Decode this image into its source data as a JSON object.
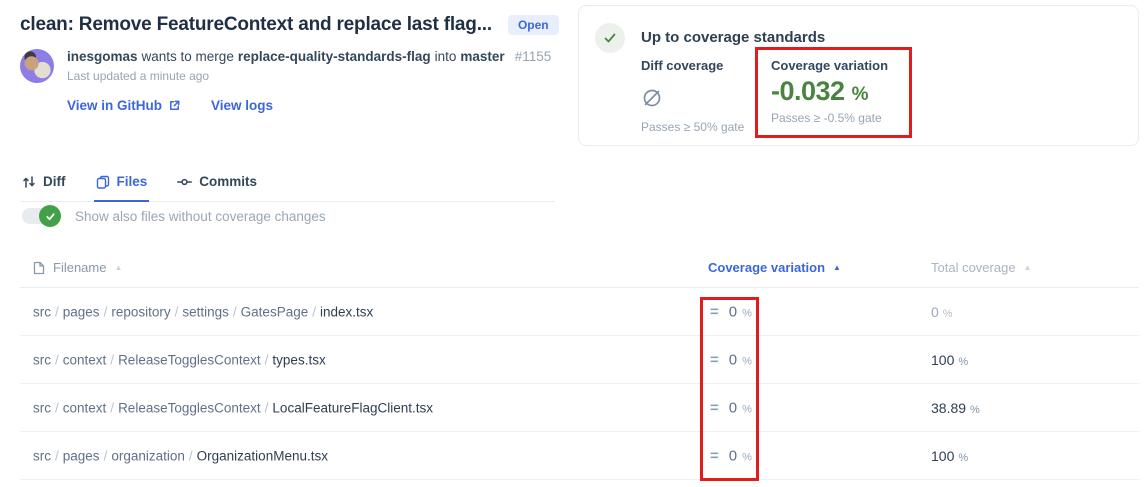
{
  "pr": {
    "title": "clean: Remove FeatureContext and replace last flag...",
    "status": "Open",
    "author": "inesgomas",
    "action": "wants to merge",
    "source_branch": "replace-quality-standards-flag",
    "into_word": "into",
    "target_branch": "master",
    "number": "#1155",
    "last_updated": "Last updated a minute ago",
    "view_in_github": "View in GitHub",
    "view_logs": "View logs"
  },
  "coverage_card": {
    "title": "Up to coverage standards",
    "status_icon": "check-circle-icon",
    "columns": [
      {
        "label": "Diff coverage",
        "value": null,
        "value_icon": "empty-set-icon",
        "gate": "Passes ≥ 50% gate"
      },
      {
        "label": "Coverage variation",
        "value": "-0.032",
        "unit": "%",
        "gate": "Passes ≥ -0.5% gate",
        "highlighted": true
      }
    ]
  },
  "tabs": [
    {
      "label": "Diff",
      "icon": "compare-icon",
      "active": false
    },
    {
      "label": "Files",
      "icon": "files-icon",
      "active": true
    },
    {
      "label": "Commits",
      "icon": "commit-icon",
      "active": false
    }
  ],
  "filter_toggle": {
    "label": "Show also files without coverage changes",
    "state": "on"
  },
  "files_table": {
    "headers": [
      {
        "label": "Filename",
        "icon": "file-icon",
        "sort": "inactive"
      },
      {
        "label": "Coverage variation",
        "sort": "ascending-active"
      },
      {
        "label": "Total coverage",
        "sort": "inactive"
      }
    ],
    "rows": [
      {
        "path": [
          "src",
          "pages",
          "repository",
          "settings",
          "GatesPage"
        ],
        "filename": "index.tsx",
        "variation_icon": "equals-icon",
        "variation": "0",
        "variation_unit": "%",
        "total": "0",
        "total_unit": "%",
        "total_muted": true
      },
      {
        "path": [
          "src",
          "context",
          "ReleaseTogglesContext"
        ],
        "filename": "types.tsx",
        "variation_icon": "equals-icon",
        "variation": "0",
        "variation_unit": "%",
        "total": "100",
        "total_unit": "%",
        "total_muted": false
      },
      {
        "path": [
          "src",
          "context",
          "ReleaseTogglesContext"
        ],
        "filename": "LocalFeatureFlagClient.tsx",
        "variation_icon": "equals-icon",
        "variation": "0",
        "variation_unit": "%",
        "total": "38.89",
        "total_unit": "%",
        "total_muted": false
      },
      {
        "path": [
          "src",
          "pages",
          "organization"
        ],
        "filename": "OrganizationMenu.tsx",
        "variation_icon": "equals-icon",
        "variation": "0",
        "variation_unit": "%",
        "total": "100",
        "total_unit": "%",
        "total_muted": false
      }
    ]
  },
  "colors": {
    "accent_blue": "#3b67d8",
    "variation_green": "#4b8440",
    "toggle_green": "#43a047",
    "annotation_red": "#e11c1c",
    "dark_text": "#2e3f53",
    "muted_text": "#98a4b3"
  }
}
